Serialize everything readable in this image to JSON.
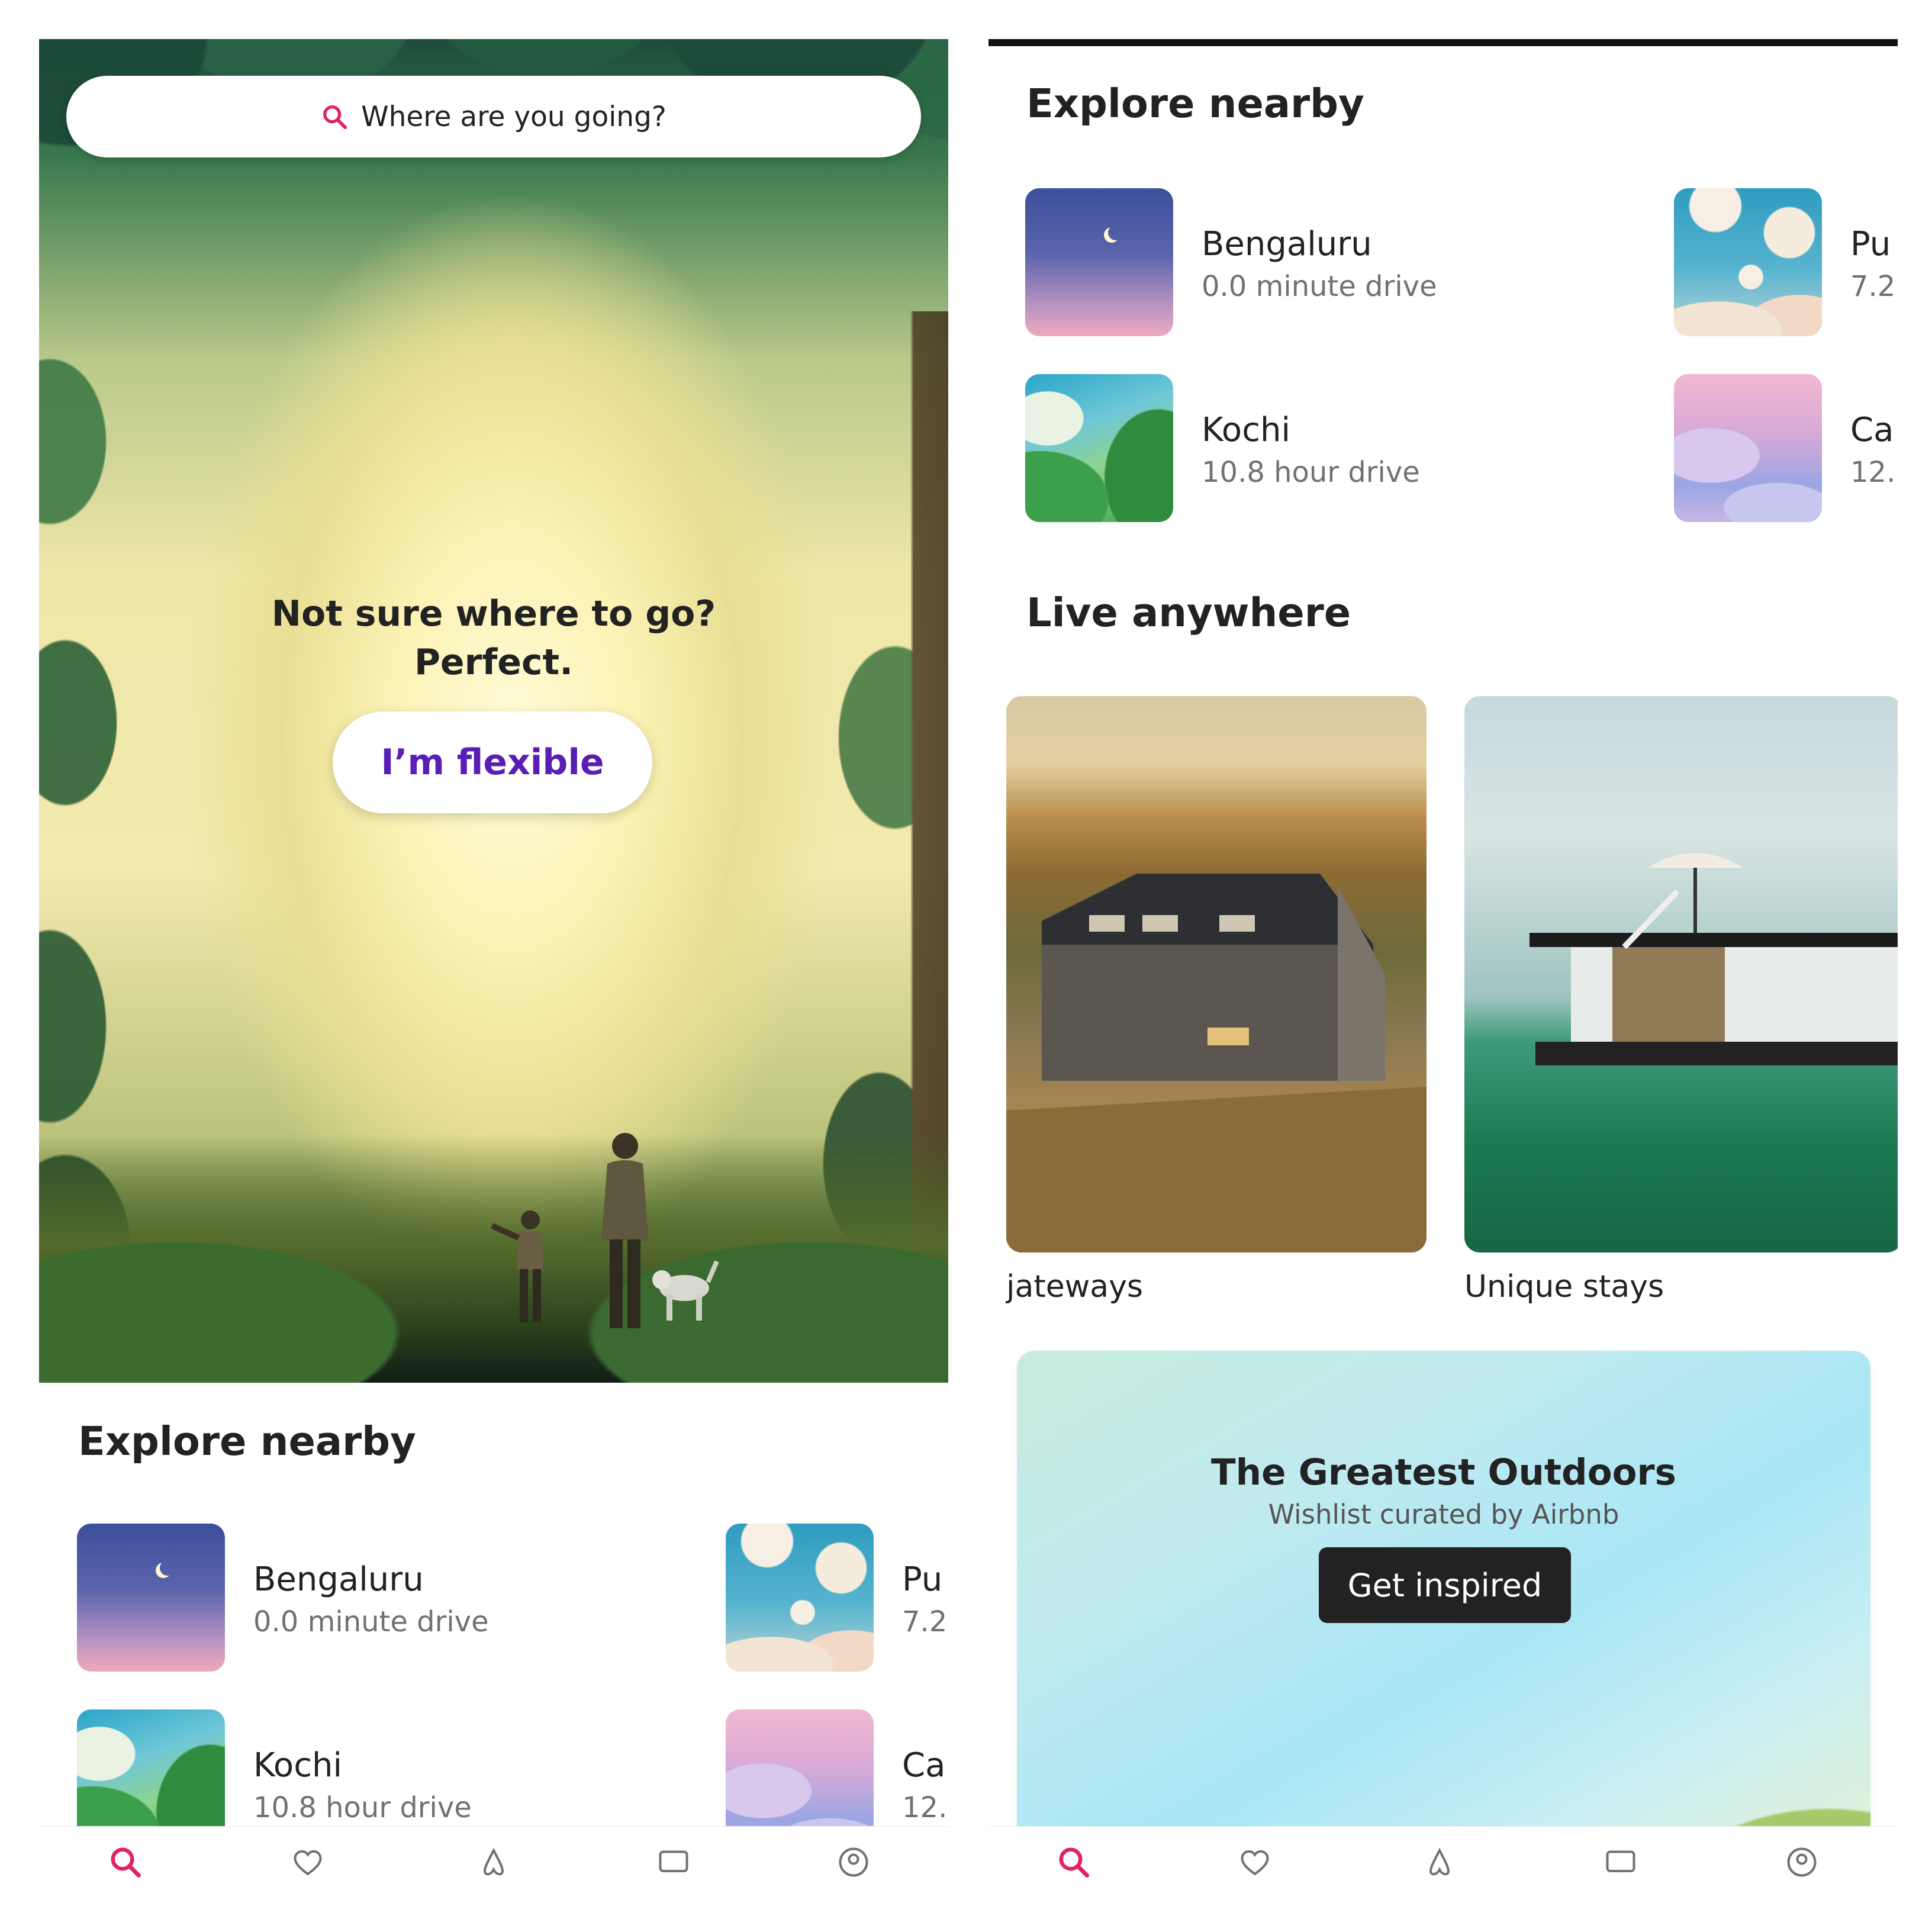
{
  "left_screen": {
    "search": {
      "placeholder": "Where are you going?"
    },
    "hero": {
      "headline_line1": "Not sure where to go?",
      "headline_line2": "Perfect.",
      "flexible_button": "I’m flexible"
    },
    "explore_nearby": {
      "title": "Explore nearby",
      "items": [
        {
          "name": "Bengaluru",
          "detail": "0.0 minute drive",
          "thumb": "night-sky"
        },
        {
          "name": "Pu",
          "detail": "7.2",
          "thumb": "clouds"
        },
        {
          "name": "Kochi",
          "detail": "10.8 hour drive",
          "thumb": "green-valley"
        },
        {
          "name": "Ca",
          "detail": "12.",
          "thumb": "dusk-birds"
        }
      ]
    },
    "tabbar": {
      "tabs": [
        {
          "icon": "search-icon",
          "active": true
        },
        {
          "icon": "heart-icon",
          "active": false
        },
        {
          "icon": "airbnb-logo-icon",
          "active": false
        },
        {
          "icon": "message-icon",
          "active": false
        },
        {
          "icon": "profile-icon",
          "active": false
        }
      ]
    }
  },
  "right_screen": {
    "explore_nearby": {
      "title": "Explore nearby",
      "items": [
        {
          "name": "Bengaluru",
          "detail": "0.0 minute drive",
          "thumb": "night-sky"
        },
        {
          "name": "Pu",
          "detail": "7.2",
          "thumb": "clouds"
        },
        {
          "name": "Kochi",
          "detail": "10.8 hour drive",
          "thumb": "green-valley"
        },
        {
          "name": "Ca",
          "detail": "12.",
          "thumb": "dusk-birds"
        }
      ]
    },
    "live_anywhere": {
      "title": "Live anywhere",
      "cards": [
        {
          "label": "jateways",
          "image": "countryside-house"
        },
        {
          "label": "Unique stays",
          "image": "floating-houseboat"
        }
      ]
    },
    "promo": {
      "title": "The Greatest Outdoors",
      "subtitle": "Wishlist curated by Airbnb",
      "button": "Get inspired"
    }
  },
  "colors": {
    "brand": "#ff385c",
    "flexible_text": "#5a1db5",
    "text_primary": "#222222",
    "text_secondary": "#717171",
    "button_dark": "#222222"
  }
}
